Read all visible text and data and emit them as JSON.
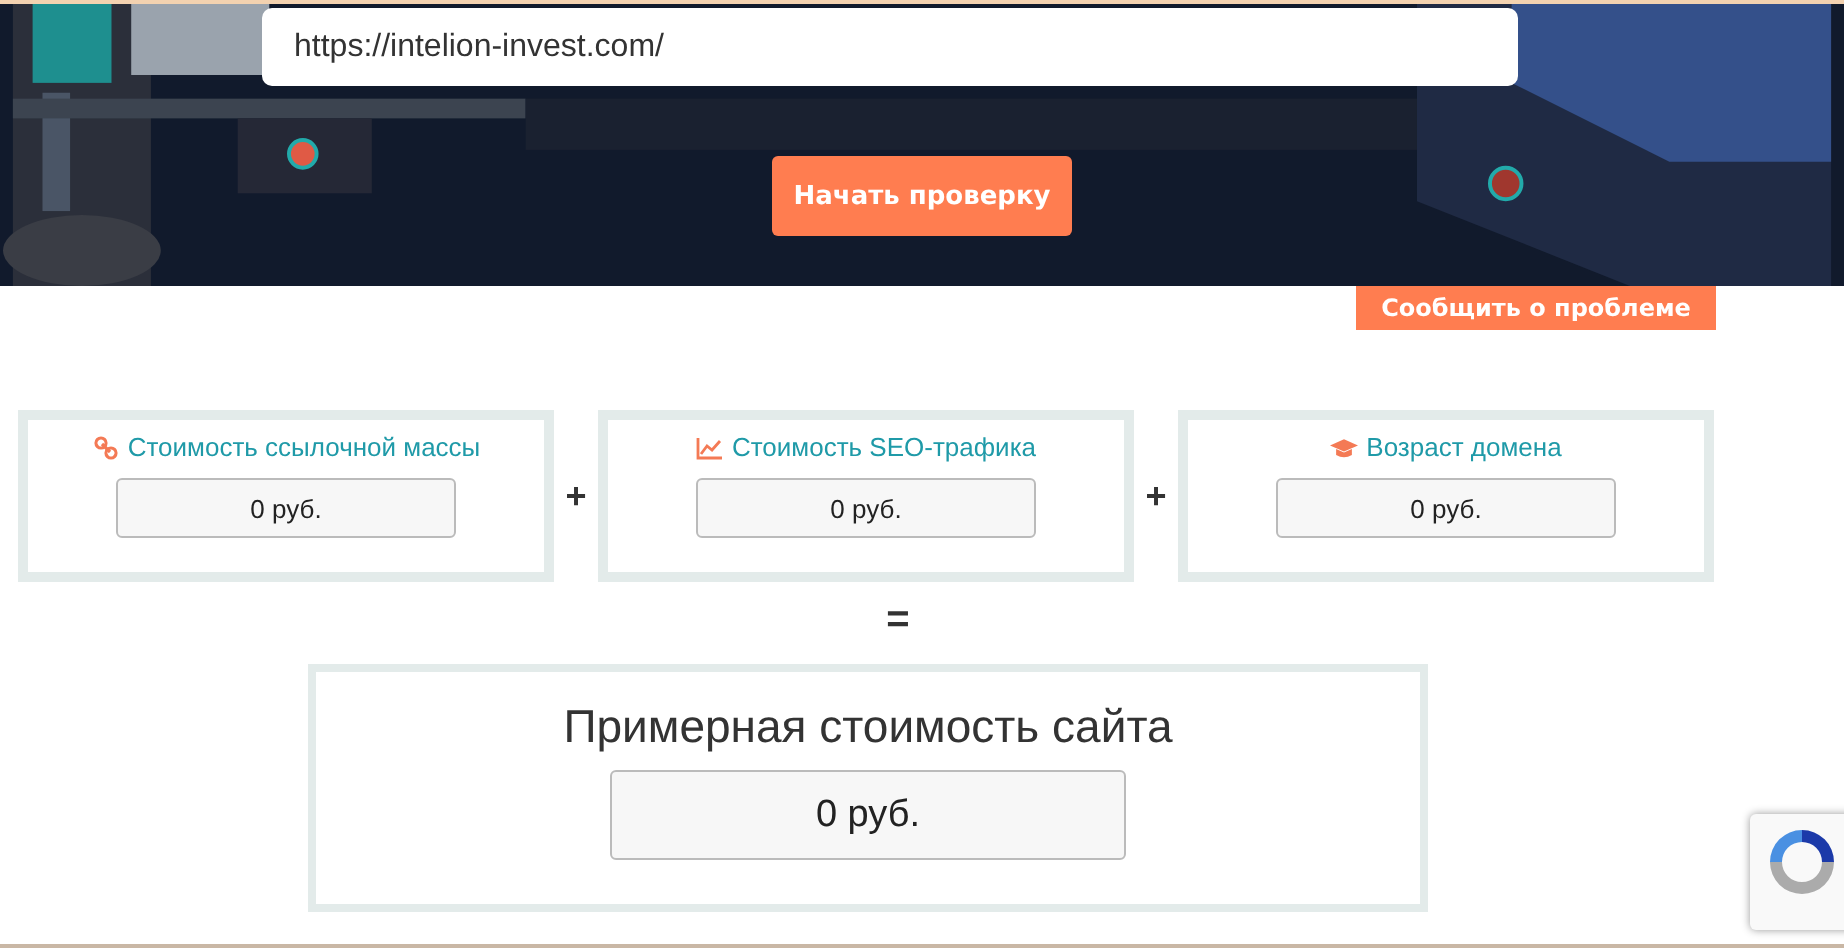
{
  "check_form": {
    "url_value": "https://intelion-invest.com/",
    "submit_label": "Начать проверку"
  },
  "report_button": "Сообщить о проблеме",
  "metrics": [
    {
      "kind": "links",
      "label": "Стоимость ссылочной массы",
      "value": "0 руб."
    },
    {
      "kind": "traffic",
      "label": "Стоимость SEO-трафика",
      "value": "0 руб."
    },
    {
      "kind": "age",
      "label": "Возраст домена",
      "value": "0 руб."
    }
  ],
  "operators": [
    "+",
    "+"
  ],
  "equals": "=",
  "total": {
    "title": "Примерная стоимость сайта",
    "value": "0 руб."
  }
}
